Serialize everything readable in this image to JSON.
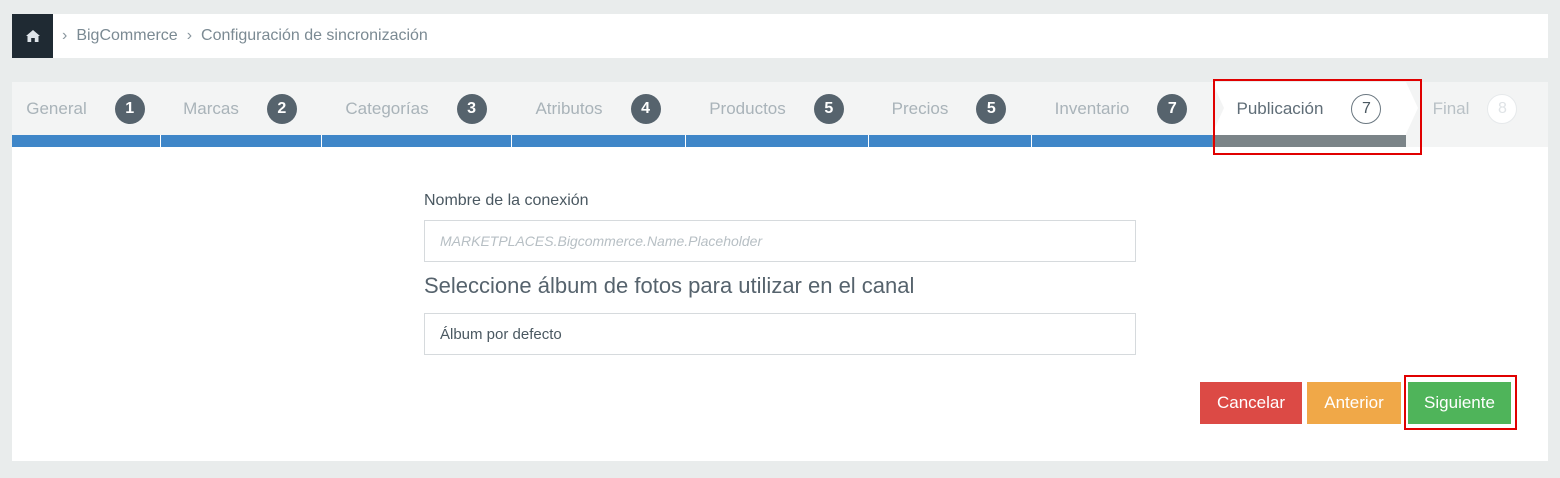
{
  "breadcrumb": {
    "home_icon": "home-icon",
    "items": [
      "BigCommerce",
      "Configuración de sincronización"
    ]
  },
  "steps": [
    {
      "label": "General",
      "num": "1",
      "state": "done"
    },
    {
      "label": "Marcas",
      "num": "2",
      "state": "done"
    },
    {
      "label": "Categorías",
      "num": "3",
      "state": "done"
    },
    {
      "label": "Atributos",
      "num": "4",
      "state": "done"
    },
    {
      "label": "Productos",
      "num": "5",
      "state": "done"
    },
    {
      "label": "Precios",
      "num": "5",
      "state": "done"
    },
    {
      "label": "Inventario",
      "num": "7",
      "state": "done"
    },
    {
      "label": "Publicación",
      "num": "7",
      "state": "active"
    },
    {
      "label": "Final",
      "num": "8",
      "state": "future"
    }
  ],
  "form": {
    "connection_label": "Nombre de la conexión",
    "connection_placeholder": "MARKETPLACES.Bigcommerce.Name.Placeholder",
    "album_title": "Seleccione álbum de fotos para utilizar en el canal",
    "album_value": "Álbum por defecto"
  },
  "buttons": {
    "cancel": "Cancelar",
    "previous": "Anterior",
    "next": "Siguiente"
  },
  "colors": {
    "progress": "#3f86c8",
    "cancel": "#dc4a45",
    "previous": "#f0a848",
    "next": "#4fb45a",
    "highlight": "#e00000"
  }
}
